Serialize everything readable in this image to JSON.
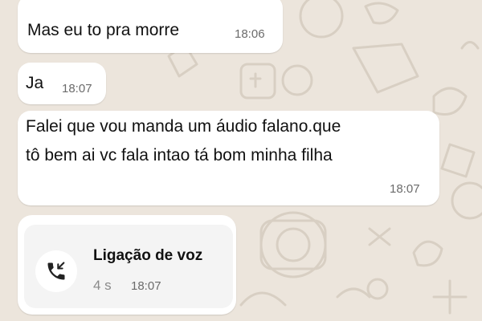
{
  "chat": {
    "messages": [
      {
        "text": "Mas eu to pra morre",
        "time": "18:06"
      },
      {
        "text": "Ja",
        "time": "18:07"
      },
      {
        "lines": [
          "Falei que vou manda um áudio falano.que",
          "tô bem ai vc fala intao tá bom minha filha"
        ],
        "time": "18:07"
      }
    ],
    "call": {
      "title": "Ligação de voz",
      "duration": "4 s",
      "time": "18:07",
      "icon": "incoming-call-icon"
    }
  },
  "colors": {
    "background": "#ece5dc",
    "bubble": "#ffffff",
    "call_card": "#f4f4f4",
    "timestamp": "#6b6b6b"
  }
}
